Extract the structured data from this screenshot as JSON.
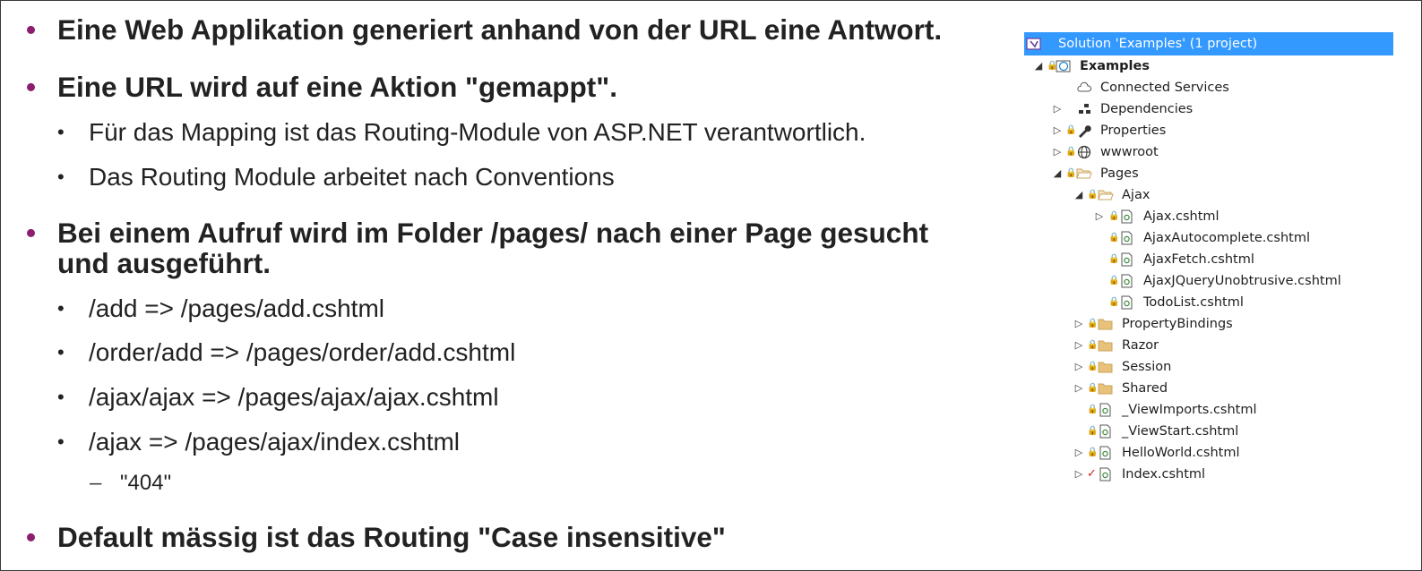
{
  "slide": {
    "bullets": [
      {
        "text": "Eine Web Applikation generiert anhand von der URL eine Antwort."
      },
      {
        "text": "Eine URL wird auf eine Aktion \"gemappt\".",
        "sub": [
          "Für das Mapping ist das Routing-Module von ASP.NET verantwortlich.",
          "Das Routing Module arbeitet nach Conventions"
        ]
      },
      {
        "line1": "Bei einem Aufruf wird im Folder /pages/ nach einer Page gesucht",
        "line2": "und ausgeführt.",
        "sub": [
          "/add => /pages/add.cshtml",
          "/order/add => /pages/order/add.cshtml",
          "/ajax/ajax => /pages/ajax/ajax.cshtml",
          "/ajax => /pages/ajax/index.cshtml"
        ],
        "subsub": "\"404\""
      },
      {
        "text": "Default mässig ist das Routing \"Case insensitive\""
      }
    ],
    "bullet_glyph": "•",
    "dash_glyph": "–",
    "accent_color": "#8b1e6e"
  },
  "solution_explorer": {
    "solution_label": "Solution 'Examples' (1 project)",
    "selection_color": "#3399ff",
    "items": [
      {
        "label": "Examples",
        "icon": "web-project-icon"
      },
      {
        "label": "Connected Services",
        "icon": "cloud-icon"
      },
      {
        "label": "Dependencies",
        "icon": "dependencies-icon"
      },
      {
        "label": "Properties",
        "icon": "wrench-icon"
      },
      {
        "label": "wwwroot",
        "icon": "globe-icon"
      },
      {
        "label": "Pages",
        "icon": "folder-open-icon"
      },
      {
        "label": "Ajax",
        "icon": "folder-open-icon"
      },
      {
        "label": "Ajax.cshtml",
        "icon": "razor-file-icon"
      },
      {
        "label": "AjaxAutocomplete.cshtml",
        "icon": "razor-file-icon"
      },
      {
        "label": "AjaxFetch.cshtml",
        "icon": "razor-file-icon"
      },
      {
        "label": "AjaxJQueryUnobtrusive.cshtml",
        "icon": "razor-file-icon"
      },
      {
        "label": "TodoList.cshtml",
        "icon": "razor-file-icon"
      },
      {
        "label": "PropertyBindings",
        "icon": "folder-icon"
      },
      {
        "label": "Razor",
        "icon": "folder-icon"
      },
      {
        "label": "Session",
        "icon": "folder-icon"
      },
      {
        "label": "Shared",
        "icon": "folder-icon"
      },
      {
        "label": "_ViewImports.cshtml",
        "icon": "razor-file-icon"
      },
      {
        "label": "_ViewStart.cshtml",
        "icon": "razor-file-icon"
      },
      {
        "label": "HelloWorld.cshtml",
        "icon": "razor-file-icon"
      },
      {
        "label": "Index.cshtml",
        "icon": "razor-file-icon"
      }
    ]
  }
}
